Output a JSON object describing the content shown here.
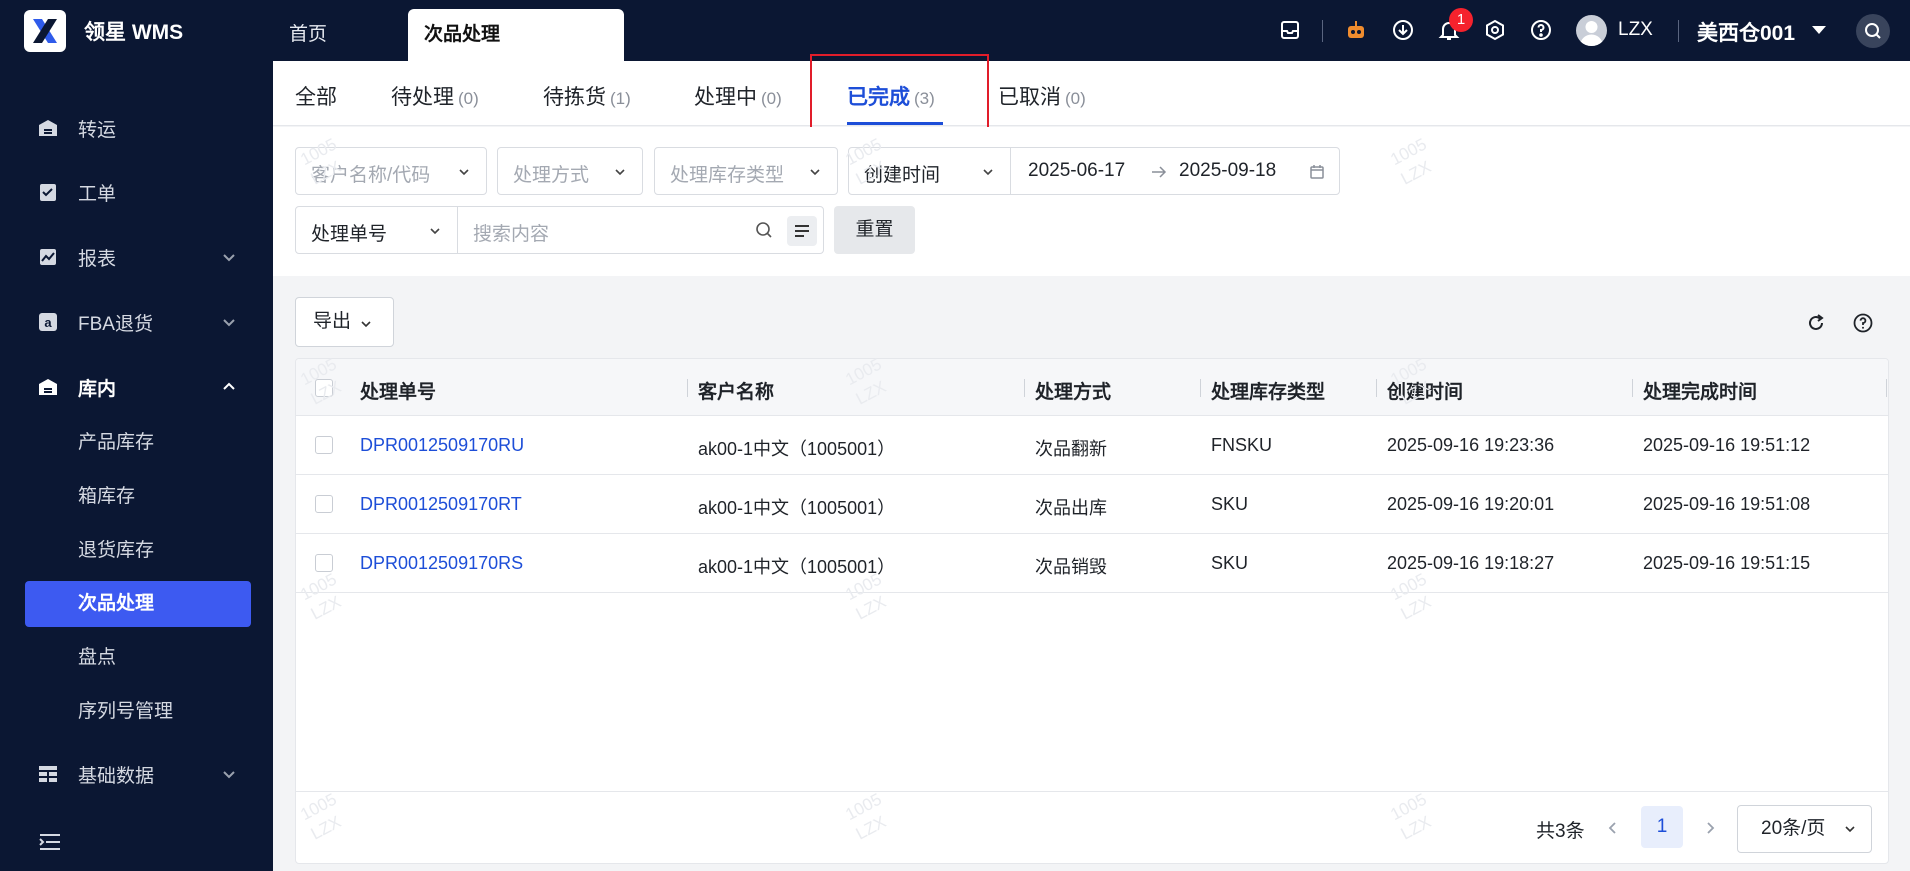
{
  "app": {
    "logo_text": "领星 WMS"
  },
  "top_tabs": {
    "home": "首页",
    "active": "次品处理"
  },
  "header": {
    "notification_count": "1",
    "user": "LZX",
    "warehouse": "美西仓001"
  },
  "sidebar": {
    "items": [
      {
        "label": "转运"
      },
      {
        "label": "工单"
      },
      {
        "label": "报表"
      },
      {
        "label": "FBA退货"
      },
      {
        "label": "库内"
      },
      {
        "label": "基础数据"
      }
    ],
    "sub_items": [
      {
        "label": "产品库存"
      },
      {
        "label": "箱库存"
      },
      {
        "label": "退货库存"
      },
      {
        "label": "次品处理"
      },
      {
        "label": "盘点"
      },
      {
        "label": "序列号管理"
      }
    ]
  },
  "status_tabs": [
    {
      "label": "全部",
      "count": ""
    },
    {
      "label": "待处理",
      "count": "(0)"
    },
    {
      "label": "待拣货",
      "count": "(1)"
    },
    {
      "label": "处理中",
      "count": "(0)"
    },
    {
      "label": "已完成",
      "count": "(3)"
    },
    {
      "label": "已取消",
      "count": "(0)"
    }
  ],
  "filters": {
    "customer_placeholder": "客户名称/代码",
    "method_placeholder": "处理方式",
    "stock_type_placeholder": "处理库存类型",
    "time_type": "创建时间",
    "date_start": "2025-06-17",
    "date_end": "2025-09-18",
    "search_field": "处理单号",
    "search_placeholder": "搜索内容",
    "reset_label": "重置"
  },
  "toolbar": {
    "export_label": "导出"
  },
  "table": {
    "columns": [
      "处理单号",
      "客户名称",
      "处理方式",
      "处理库存类型",
      "创建时间",
      "处理完成时间"
    ],
    "rows": [
      [
        "DPR0012509170RU",
        "ak00-1中文（1005001）",
        "次品翻新",
        "FNSKU",
        "2025-09-16 19:23:36",
        "2025-09-16 19:51:12"
      ],
      [
        "DPR0012509170RT",
        "ak00-1中文（1005001）",
        "次品出库",
        "SKU",
        "2025-09-16 19:20:01",
        "2025-09-16 19:51:08"
      ],
      [
        "DPR0012509170RS",
        "ak00-1中文（1005001）",
        "次品销毁",
        "SKU",
        "2025-09-16 19:18:27",
        "2025-09-16 19:51:15"
      ]
    ]
  },
  "pagination": {
    "total": "共3条",
    "current_page": "1",
    "page_size": "20条/页"
  },
  "watermark": {
    "line1": "1005",
    "line2": "LZX"
  },
  "colors": {
    "primary": "#1d4ed8",
    "sidebar_bg": "#0b1733",
    "active_menu": "#3d5af1",
    "highlight_box": "#e11d2a"
  }
}
